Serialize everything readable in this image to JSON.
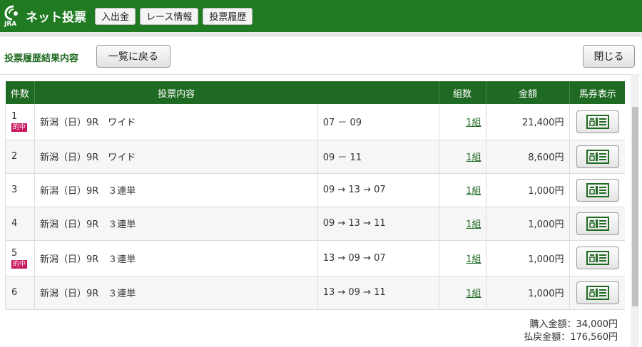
{
  "header": {
    "logo_text": "ネット投票",
    "logo_sub": "JRA",
    "nav": [
      "入出金",
      "レース情報",
      "投票履歴"
    ]
  },
  "modal": {
    "title": "投票履歴結果内容",
    "back_label": "一覧に戻る",
    "close_label": "閉じる"
  },
  "table": {
    "columns": [
      "件数",
      "投票内容",
      "組数",
      "金額",
      "馬券表示"
    ],
    "rows": [
      {
        "no": "1",
        "hit": "的中",
        "content": "新潟（日）9R　ワイド",
        "combo": "07 － 09",
        "sets": "1組",
        "amount": "21,400円"
      },
      {
        "no": "2",
        "hit": "",
        "content": "新潟（日）9R　ワイド",
        "combo": "09 － 11",
        "sets": "1組",
        "amount": "8,600円"
      },
      {
        "no": "3",
        "hit": "",
        "content": "新潟（日）9R　３連単",
        "combo": "09 → 13 → 07",
        "sets": "1組",
        "amount": "1,000円"
      },
      {
        "no": "4",
        "hit": "",
        "content": "新潟（日）9R　３連単",
        "combo": "09 → 13 → 11",
        "sets": "1組",
        "amount": "1,000円"
      },
      {
        "no": "5",
        "hit": "的中",
        "content": "新潟（日）9R　３連単",
        "combo": "13 → 09 → 07",
        "sets": "1組",
        "amount": "1,000円"
      },
      {
        "no": "6",
        "hit": "",
        "content": "新潟（日）9R　３連単",
        "combo": "13 → 09 → 11",
        "sets": "1組",
        "amount": "1,000円"
      }
    ]
  },
  "summary": {
    "purchase": "購入金額：34,000円",
    "payout": "払戻金額：176,560円"
  },
  "colors": {
    "brand_green": "#1f7a22",
    "header_green": "#1f6a22",
    "hit_badge": "#c8185f"
  }
}
